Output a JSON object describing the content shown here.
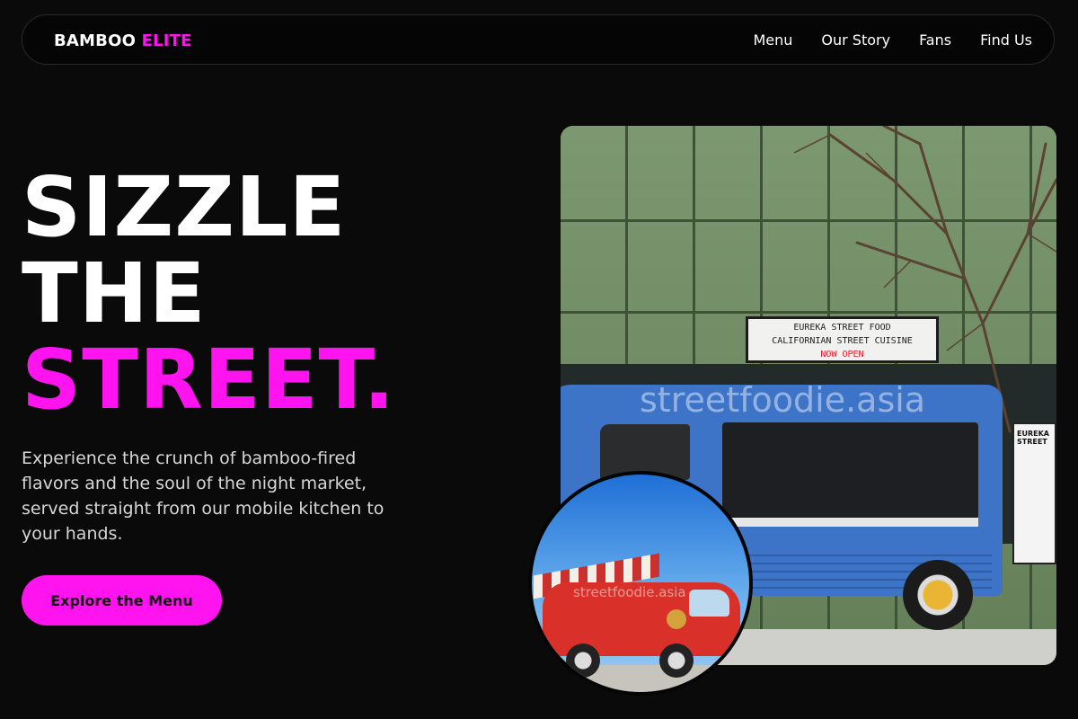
{
  "brand": {
    "name": "BAMBOO",
    "accent": "ELITE"
  },
  "nav": {
    "links": [
      "Menu",
      "Our Story",
      "Fans",
      "Find Us"
    ]
  },
  "hero": {
    "title_lines": [
      "SIZZLE",
      "THE"
    ],
    "title_accent": "STREET.",
    "description": "Experience the crunch of bamboo-fired flavors and the soul of the night market, served straight from our mobile kitchen to your hands.",
    "cta_label": "Explore the Menu"
  },
  "photo_main": {
    "sign_line1": "EUREKA STREET FOOD",
    "sign_line2": "CALIFORNIAN STREET CUISINE",
    "sign_line3": "NOW OPEN",
    "watermark": "streetfoodie.asia",
    "menu_board": "EUREKA STREET"
  },
  "photo_circle": {
    "watermark": "streetfoodie.asia"
  },
  "colors": {
    "accent": "#ff14f0",
    "background": "#0a0a0a"
  }
}
